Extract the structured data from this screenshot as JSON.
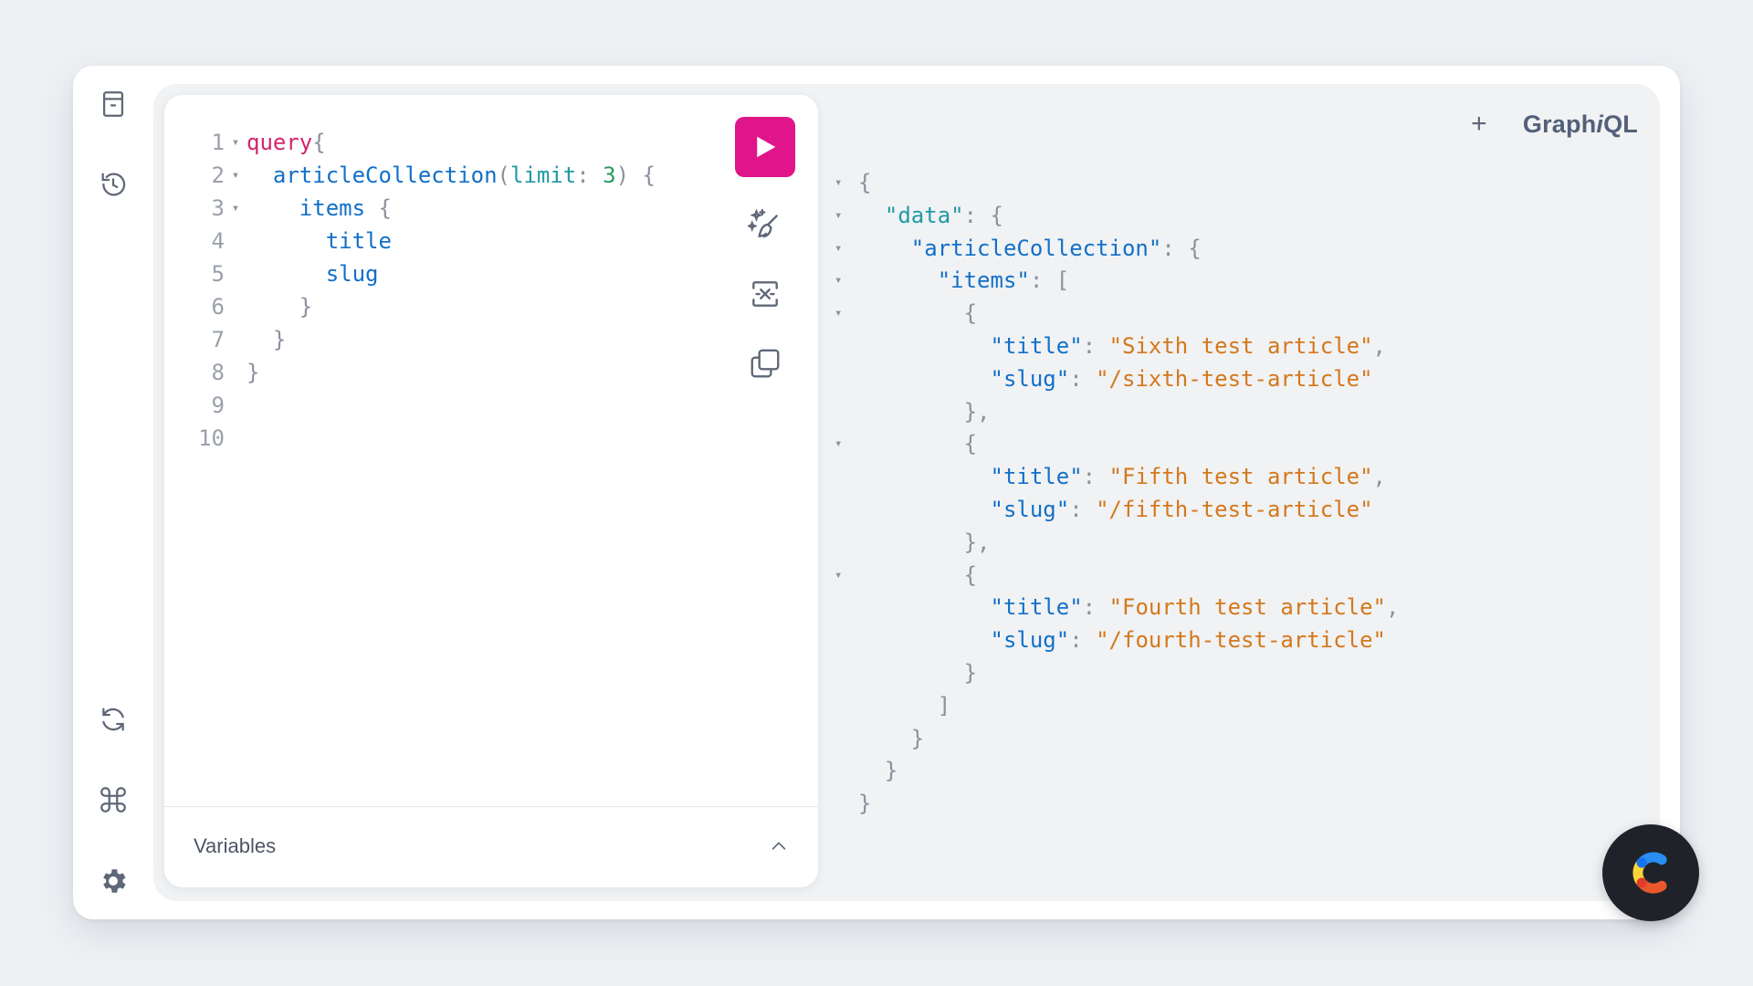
{
  "app": {
    "logo_prefix": "Graph",
    "logo_italic": "i",
    "logo_suffix": "QL",
    "new_tab_label": "+"
  },
  "sidebar": {
    "top": [
      {
        "name": "docs-icon"
      },
      {
        "name": "history-icon"
      }
    ],
    "bottom": [
      {
        "name": "refetch-schema-icon"
      },
      {
        "name": "shortcuts-icon"
      },
      {
        "name": "settings-icon"
      }
    ]
  },
  "editor": {
    "lines": [
      {
        "n": "1",
        "fold": "▾",
        "tokens": [
          {
            "t": "query",
            "c": "kw"
          },
          {
            "t": "{",
            "c": "punc"
          }
        ]
      },
      {
        "n": "2",
        "fold": "▾",
        "tokens": [
          {
            "t": "  "
          },
          {
            "t": "articleCollection",
            "c": "fn"
          },
          {
            "t": "(",
            "c": "punc"
          },
          {
            "t": "limit",
            "c": "arg"
          },
          {
            "t": ": ",
            "c": "punc"
          },
          {
            "t": "3",
            "c": "num"
          },
          {
            "t": ") {",
            "c": "punc"
          }
        ]
      },
      {
        "n": "3",
        "fold": "▾",
        "tokens": [
          {
            "t": "    "
          },
          {
            "t": "items",
            "c": "fn"
          },
          {
            "t": " {",
            "c": "punc"
          }
        ]
      },
      {
        "n": "4",
        "fold": "",
        "tokens": [
          {
            "t": "      "
          },
          {
            "t": "title",
            "c": "fn"
          }
        ]
      },
      {
        "n": "5",
        "fold": "",
        "tokens": [
          {
            "t": "      "
          },
          {
            "t": "slug",
            "c": "fn"
          }
        ]
      },
      {
        "n": "6",
        "fold": "",
        "tokens": [
          {
            "t": "    "
          },
          {
            "t": "}",
            "c": "punc"
          }
        ]
      },
      {
        "n": "7",
        "fold": "",
        "tokens": [
          {
            "t": "  "
          },
          {
            "t": "}",
            "c": "punc"
          }
        ]
      },
      {
        "n": "8",
        "fold": "",
        "tokens": [
          {
            "t": "}",
            "c": "punc"
          }
        ]
      },
      {
        "n": "9",
        "fold": "",
        "tokens": []
      },
      {
        "n": "10",
        "fold": "",
        "tokens": []
      }
    ],
    "toolbar": [
      {
        "name": "prettify-button"
      },
      {
        "name": "merge-fragments-button"
      },
      {
        "name": "copy-query-button"
      }
    ],
    "variables_label": "Variables"
  },
  "result": {
    "lines": [
      {
        "fold": "▾",
        "tokens": [
          {
            "t": "{",
            "c": "punc"
          }
        ]
      },
      {
        "fold": "▾",
        "tokens": [
          {
            "t": "  "
          },
          {
            "t": "\"data\"",
            "c": "arg"
          },
          {
            "t": ": {",
            "c": "punc"
          }
        ]
      },
      {
        "fold": "▾",
        "tokens": [
          {
            "t": "    "
          },
          {
            "t": "\"articleCollection\"",
            "c": "key"
          },
          {
            "t": ": {",
            "c": "punc"
          }
        ]
      },
      {
        "fold": "▾",
        "tokens": [
          {
            "t": "      "
          },
          {
            "t": "\"items\"",
            "c": "key"
          },
          {
            "t": ": [",
            "c": "punc"
          }
        ]
      },
      {
        "fold": "▾",
        "tokens": [
          {
            "t": "        "
          },
          {
            "t": "{",
            "c": "punc"
          }
        ]
      },
      {
        "fold": "",
        "tokens": [
          {
            "t": "          "
          },
          {
            "t": "\"title\"",
            "c": "key"
          },
          {
            "t": ": ",
            "c": "punc"
          },
          {
            "t": "\"Sixth test article\"",
            "c": "str"
          },
          {
            "t": ",",
            "c": "punc"
          }
        ]
      },
      {
        "fold": "",
        "tokens": [
          {
            "t": "          "
          },
          {
            "t": "\"slug\"",
            "c": "key"
          },
          {
            "t": ": ",
            "c": "punc"
          },
          {
            "t": "\"/sixth-test-article\"",
            "c": "str"
          }
        ]
      },
      {
        "fold": "",
        "tokens": [
          {
            "t": "        "
          },
          {
            "t": "},",
            "c": "punc"
          }
        ]
      },
      {
        "fold": "▾",
        "tokens": [
          {
            "t": "        "
          },
          {
            "t": "{",
            "c": "punc"
          }
        ]
      },
      {
        "fold": "",
        "tokens": [
          {
            "t": "          "
          },
          {
            "t": "\"title\"",
            "c": "key"
          },
          {
            "t": ": ",
            "c": "punc"
          },
          {
            "t": "\"Fifth test article\"",
            "c": "str"
          },
          {
            "t": ",",
            "c": "punc"
          }
        ]
      },
      {
        "fold": "",
        "tokens": [
          {
            "t": "          "
          },
          {
            "t": "\"slug\"",
            "c": "key"
          },
          {
            "t": ": ",
            "c": "punc"
          },
          {
            "t": "\"/fifth-test-article\"",
            "c": "str"
          }
        ]
      },
      {
        "fold": "",
        "tokens": [
          {
            "t": "        "
          },
          {
            "t": "},",
            "c": "punc"
          }
        ]
      },
      {
        "fold": "▾",
        "tokens": [
          {
            "t": "        "
          },
          {
            "t": "{",
            "c": "punc"
          }
        ]
      },
      {
        "fold": "",
        "tokens": [
          {
            "t": "          "
          },
          {
            "t": "\"title\"",
            "c": "key"
          },
          {
            "t": ": ",
            "c": "punc"
          },
          {
            "t": "\"Fourth test article\"",
            "c": "str"
          },
          {
            "t": ",",
            "c": "punc"
          }
        ]
      },
      {
        "fold": "",
        "tokens": [
          {
            "t": "          "
          },
          {
            "t": "\"slug\"",
            "c": "key"
          },
          {
            "t": ": ",
            "c": "punc"
          },
          {
            "t": "\"/fourth-test-article\"",
            "c": "str"
          }
        ]
      },
      {
        "fold": "",
        "tokens": [
          {
            "t": "        "
          },
          {
            "t": "}",
            "c": "punc"
          }
        ]
      },
      {
        "fold": "",
        "tokens": [
          {
            "t": "      "
          },
          {
            "t": "]",
            "c": "punc"
          }
        ]
      },
      {
        "fold": "",
        "tokens": [
          {
            "t": "    "
          },
          {
            "t": "}",
            "c": "punc"
          }
        ]
      },
      {
        "fold": "",
        "tokens": [
          {
            "t": "  "
          },
          {
            "t": "}",
            "c": "punc"
          }
        ]
      },
      {
        "fold": "",
        "tokens": [
          {
            "t": "}",
            "c": "punc"
          }
        ]
      }
    ]
  },
  "colors": {
    "run_button": "#e0158a",
    "keyword": "#d6246b",
    "field": "#1270c8",
    "string": "#d4781c"
  },
  "badge": {
    "name": "contentful-logo-icon"
  }
}
